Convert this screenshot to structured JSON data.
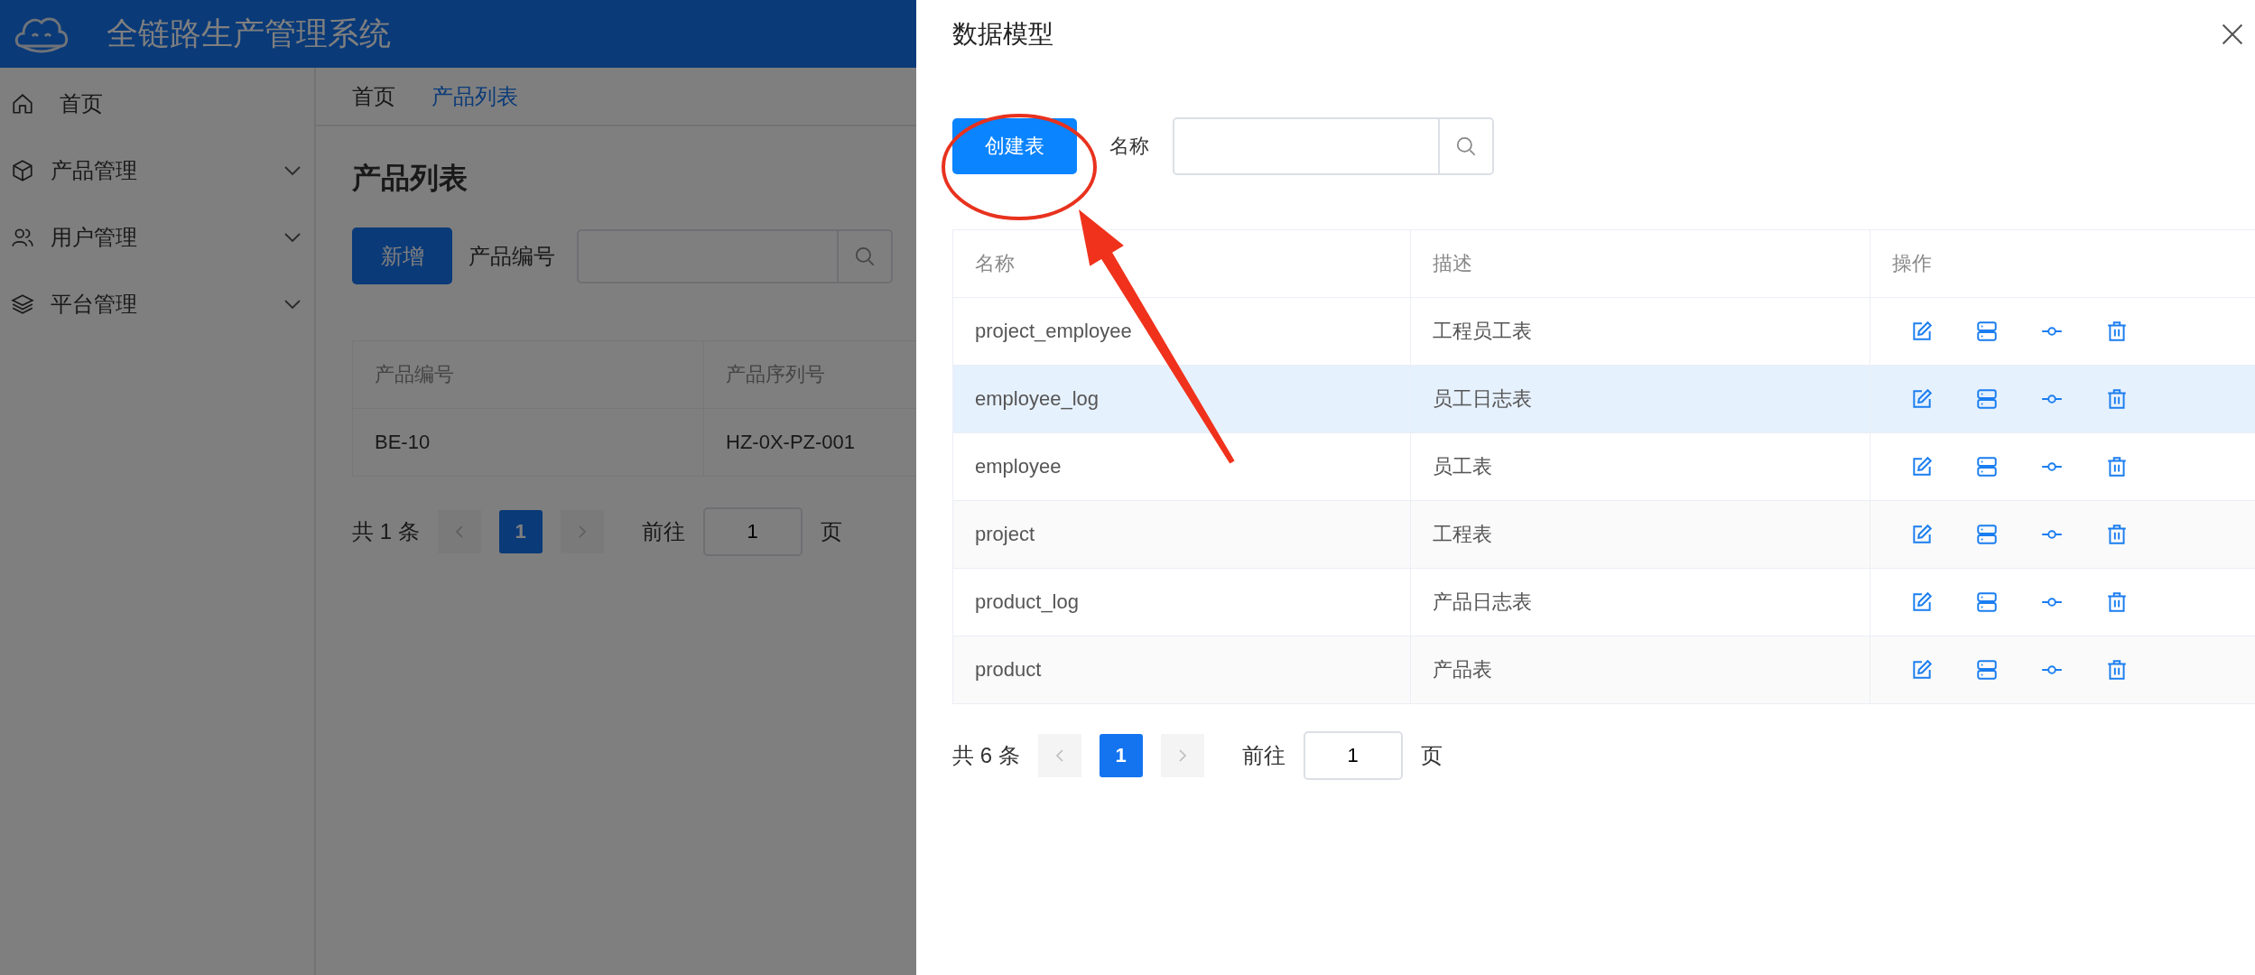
{
  "app": {
    "title": "全链路生产管理系统"
  },
  "sidebar": {
    "items": [
      {
        "label": "首页",
        "kind": "home"
      },
      {
        "label": "产品管理",
        "kind": "cube",
        "expanded": false
      },
      {
        "label": "用户管理",
        "kind": "users",
        "expanded": false
      },
      {
        "label": "平台管理",
        "kind": "layers",
        "expanded": false
      }
    ]
  },
  "breadcrumb": [
    {
      "label": "首页",
      "current": false
    },
    {
      "label": "产品列表",
      "current": true
    }
  ],
  "page": {
    "title": "产品列表",
    "add_button": "新增",
    "filter_label": "产品编号",
    "table": {
      "columns": [
        "产品编号",
        "产品序列号"
      ],
      "rows": [
        [
          "BE-10",
          "HZ-0X-PZ-001"
        ]
      ]
    },
    "pagination": {
      "total": "共 1 条",
      "pages": [
        {
          "label": "1",
          "selected": true
        }
      ],
      "goto_label": "前往",
      "goto_value": "1",
      "page_unit": "页"
    }
  },
  "drawer": {
    "title": "数据模型",
    "create_button": "创建表",
    "filter_label": "名称",
    "table": {
      "columns": [
        "名称",
        "描述",
        "操作"
      ],
      "rows": [
        {
          "name": "project_employee",
          "description": "工程员工表",
          "selected": false
        },
        {
          "name": "employee_log",
          "description": "员工日志表",
          "selected": true
        },
        {
          "name": "employee",
          "description": "员工表",
          "selected": false
        },
        {
          "name": "project",
          "description": "工程表",
          "selected": false
        },
        {
          "name": "product_log",
          "description": "产品日志表",
          "selected": false
        },
        {
          "name": "product",
          "description": "产品表",
          "selected": false
        }
      ]
    },
    "pagination": {
      "total": "共 6 条",
      "pages": [
        {
          "label": "1",
          "selected": true
        }
      ],
      "goto_label": "前往",
      "goto_value": "1",
      "page_unit": "页"
    }
  }
}
